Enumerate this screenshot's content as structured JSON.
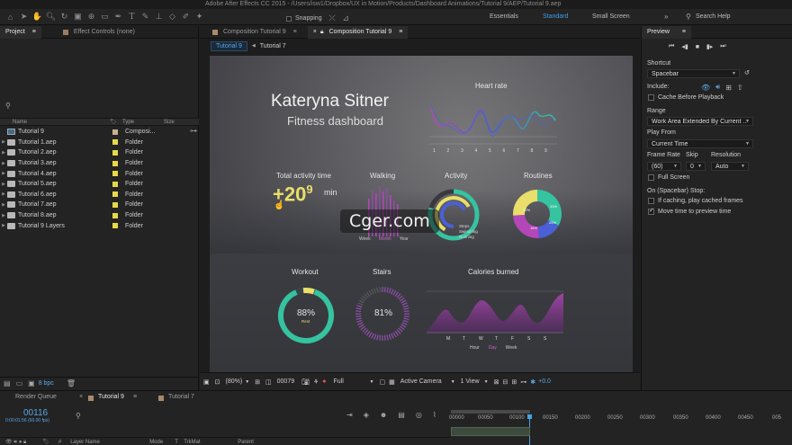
{
  "title_bar": "Adobe After Effects CC 2015 - /Users/isw1/Dropbox/UX in Motion/Products/Dashboard Animations/Tutorial 9/AEP/Tutorial 9.aep",
  "toolbar": {
    "snapping_label": "Snapping",
    "workspaces": [
      "Essentials",
      "Standard",
      "Small Screen"
    ],
    "active_workspace": "Standard",
    "search_help": "Search Help"
  },
  "project_panel": {
    "tabs": [
      "Project",
      "Effect Controls (none)"
    ],
    "columns": {
      "name": "Name",
      "type": "Type",
      "size": "Size"
    },
    "items": [
      {
        "name": "Tutorial 9",
        "type": "Composi...",
        "kind": "comp",
        "color": "#c8b08f"
      },
      {
        "name": "Tutorial 1.aep",
        "type": "Folder",
        "kind": "folder",
        "color": "#e7d84a"
      },
      {
        "name": "Tutorial 2.aep",
        "type": "Folder",
        "kind": "folder",
        "color": "#e7d84a"
      },
      {
        "name": "Tutorial 3.aep",
        "type": "Folder",
        "kind": "folder",
        "color": "#e7d84a"
      },
      {
        "name": "Tutorial 4.aep",
        "type": "Folder",
        "kind": "folder",
        "color": "#e7d84a"
      },
      {
        "name": "Tutorial 5.aep",
        "type": "Folder",
        "kind": "folder",
        "color": "#e7d84a"
      },
      {
        "name": "Tutorial 6.aep",
        "type": "Folder",
        "kind": "folder",
        "color": "#e7d84a"
      },
      {
        "name": "Tutorial 7.aep",
        "type": "Folder",
        "kind": "folder",
        "color": "#e7d84a"
      },
      {
        "name": "Tutorial 8.aep",
        "type": "Folder",
        "kind": "folder",
        "color": "#e7d84a"
      },
      {
        "name": "Tutorial 9 Layers",
        "type": "Folder",
        "kind": "folder",
        "color": "#e7d84a"
      }
    ],
    "bpc": "8 bpc"
  },
  "comp_panel": {
    "tabs": [
      "Composition Tutorial 9",
      "Composition Tutorial 9"
    ],
    "breadcrumbs": [
      "Tutorial 9",
      "Tutorial 7"
    ],
    "footer": {
      "zoom": "(80%)",
      "timecode": "00079",
      "resolution": "Full",
      "camera": "Active Camera",
      "view": "1 View",
      "exposure": "+0.0"
    }
  },
  "dashboard": {
    "name": "Kateryna Sitner",
    "subtitle": "Fitness dashboard",
    "heart_rate_title": "Heart rate",
    "heart_rate_ticks": [
      "1",
      "2",
      "3",
      "4",
      "5",
      "6",
      "7",
      "8",
      "9"
    ],
    "total_activity_title": "Total activity time",
    "total_activity_value": "+20",
    "total_activity_exp": "9",
    "total_activity_unit": "min",
    "walking_title": "Walking",
    "walking_tabs": [
      "Week",
      "Month",
      "Year"
    ],
    "activity_title": "Activity",
    "activity_legend": [
      "Steps",
      "Swimming",
      "Running"
    ],
    "routines_title": "Routines",
    "routines_labels": [
      "33%",
      "25%",
      "16%",
      "22%"
    ],
    "workout_title": "Workout",
    "workout_value": "88%",
    "workout_sub": "Rest",
    "stairs_title": "Stairs",
    "stairs_value": "81%",
    "calories_title": "Calories burned",
    "calories_days": [
      "M",
      "T",
      "W",
      "T",
      "F",
      "S",
      "S"
    ],
    "calories_tabs": [
      "Hour",
      "Day",
      "Week"
    ],
    "colors": {
      "teal": "#35c3a0",
      "yellow": "#e9df6a",
      "purple": "#8b4ea6",
      "blue": "#4b5fd6",
      "magenta": "#b347b8"
    }
  },
  "preview_panel": {
    "title": "Preview",
    "shortcut_label": "Shortcut",
    "shortcut_value": "Spacebar",
    "include_label": "Include:",
    "cache_before": "Cache Before Playback",
    "range_label": "Range",
    "range_value": "Work Area Extended By Current ...",
    "play_from_label": "Play From",
    "play_from_value": "Current Time",
    "frame_rate_label": "Frame Rate",
    "skip_label": "Skip",
    "resolution_label": "Resolution",
    "frame_rate_value": "(60)",
    "skip_value": "0",
    "resolution_value": "Auto",
    "full_screen": "Full Screen",
    "on_stop_label": "On (Spacebar) Stop:",
    "if_caching": "If caching, play cached frames",
    "move_time": "Move time to preview time"
  },
  "timeline": {
    "tabs": [
      "Render Queue",
      "Tutorial 9",
      "Tutorial 7"
    ],
    "timecode": "00116",
    "timecode_sub": "0:00:01:56 (60.00 fps)",
    "columns": [
      "Layer Name",
      "Mode",
      "T",
      "TrkMat",
      "Parent"
    ],
    "ruler": [
      "00000",
      "00050",
      "00100",
      "00150",
      "00200",
      "00250",
      "00300",
      "00350",
      "00400",
      "00450",
      "005"
    ]
  },
  "watermark": "Cger.com"
}
